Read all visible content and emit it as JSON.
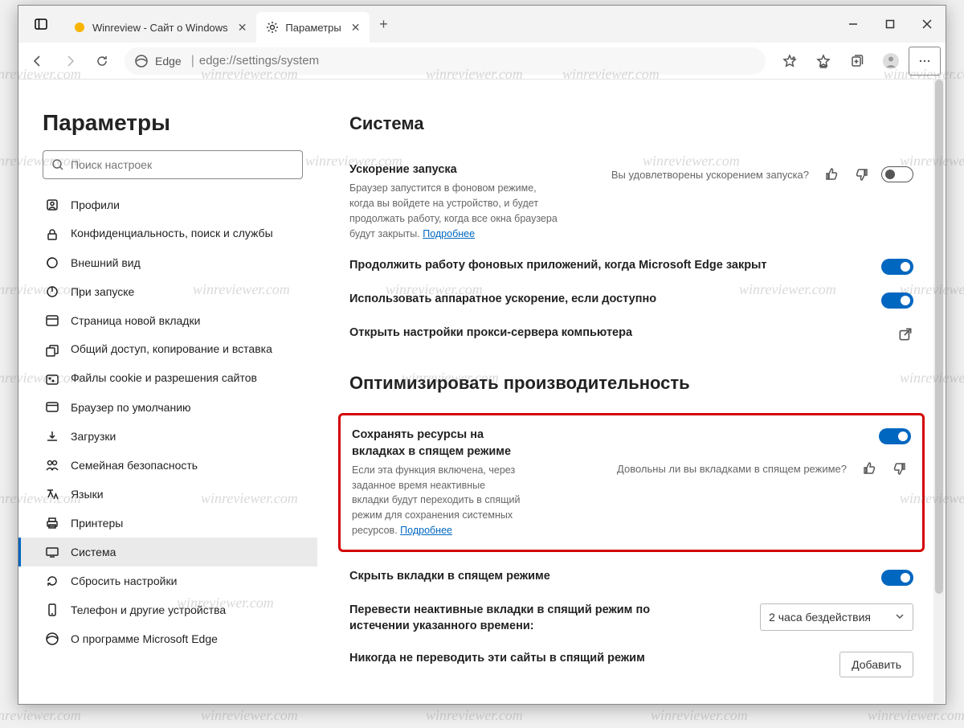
{
  "tabs": [
    {
      "title": "Winreview - Сайт о Windows"
    },
    {
      "title": "Параметры"
    }
  ],
  "toolbar": {
    "edge_label": "Edge",
    "url": "edge://settings/system"
  },
  "sidebar": {
    "heading": "Параметры",
    "search_placeholder": "Поиск настроек",
    "items": [
      {
        "label": "Профили"
      },
      {
        "label": "Конфиденциальность, поиск и службы"
      },
      {
        "label": "Внешний вид"
      },
      {
        "label": "При запуске"
      },
      {
        "label": "Страница новой вкладки"
      },
      {
        "label": "Общий доступ, копирование и вставка"
      },
      {
        "label": "Файлы cookie и разрешения сайтов"
      },
      {
        "label": "Браузер по умолчанию"
      },
      {
        "label": "Загрузки"
      },
      {
        "label": "Семейная безопасность"
      },
      {
        "label": "Языки"
      },
      {
        "label": "Принтеры"
      },
      {
        "label": "Система"
      },
      {
        "label": "Сбросить настройки"
      },
      {
        "label": "Телефон и другие устройства"
      },
      {
        "label": "О программе Microsoft Edge"
      }
    ]
  },
  "main": {
    "heading1": "Система",
    "startup_boost": {
      "title": "Ускорение запуска",
      "desc": "Браузер запустится в фоновом режиме, когда вы войдете на устройство, и будет продолжать работу, когда все окна браузера будут закрыты. ",
      "link": "Подробнее",
      "feedback": "Вы удовлетворены ускорением запуска?"
    },
    "bg_apps": {
      "title": "Продолжить работу фоновых приложений, когда Microsoft Edge закрыт"
    },
    "hw_accel": {
      "title": "Использовать аппаратное ускорение, если доступно"
    },
    "proxy": {
      "title": "Открыть настройки прокси-сервера компьютера"
    },
    "heading2": "Оптимизировать производительность",
    "sleeping_tabs": {
      "title": "Сохранять ресурсы на вкладках в спящем режиме",
      "desc": "Если эта функция включена, через заданное время неактивные вкладки будут переходить в спящий режим для сохранения системных ресурсов. ",
      "link": "Подробнее",
      "feedback": "Довольны ли вы вкладками в спящем режиме?"
    },
    "fade_tabs": {
      "title": "Скрыть вкладки в спящем режиме"
    },
    "timeout": {
      "title": "Перевести неактивные вкладки в спящий режим по истечении указанного времени:",
      "value": "2 часа бездействия"
    },
    "never_sleep": {
      "title": "Никогда не переводить эти сайты в спящий режим",
      "button": "Добавить"
    }
  },
  "watermark": "winreviewer.com"
}
